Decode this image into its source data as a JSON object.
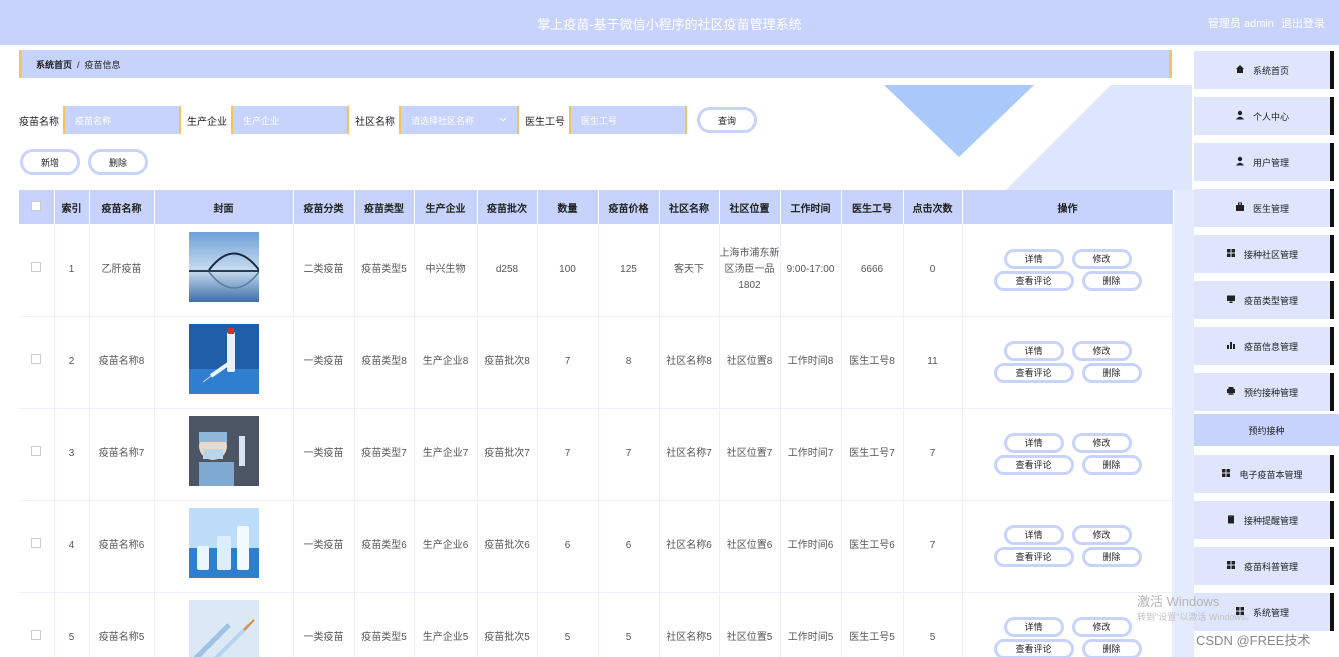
{
  "header": {
    "title": "掌上疫苗-基于微信小程序的社区疫苗管理系统",
    "user_label": "管理员 admin",
    "logout_label": "退出登录"
  },
  "breadcrumb": {
    "home": "系统首页",
    "sep": "/",
    "current": "疫苗信息"
  },
  "search": {
    "name_label": "疫苗名称",
    "name_placeholder": "疫苗名称",
    "company_label": "生产企业",
    "company_placeholder": "生产企业",
    "community_label": "社区名称",
    "community_placeholder": "请选择社区名称",
    "doctor_label": "医生工号",
    "doctor_placeholder": "医生工号",
    "query_label": "查询"
  },
  "actions": {
    "add_label": "新增",
    "delete_label": "删除"
  },
  "table": {
    "headers": [
      "索引",
      "疫苗名称",
      "封面",
      "疫苗分类",
      "疫苗类型",
      "生产企业",
      "疫苗批次",
      "数量",
      "疫苗价格",
      "社区名称",
      "社区位置",
      "工作时间",
      "医生工号",
      "点击次数",
      "操作"
    ],
    "op_labels": {
      "detail": "详情",
      "edit": "修改",
      "comments": "查看评论",
      "delete": "删除"
    },
    "rows": [
      {
        "index": "1",
        "name": "乙肝疫苗",
        "category": "二类疫苗",
        "type": "疫苗类型5",
        "company": "中兴生物",
        "batch": "d258",
        "qty": "100",
        "price": "125",
        "community": "客天下",
        "location": "上海市浦东新区汤臣一品1802",
        "worktime": "9:00-17:00",
        "doctor": "6666",
        "clicks": "0",
        "cover": "bridge"
      },
      {
        "index": "2",
        "name": "疫苗名称8",
        "category": "一类疫苗",
        "type": "疫苗类型8",
        "company": "生产企业8",
        "batch": "疫苗批次8",
        "qty": "7",
        "price": "8",
        "community": "社区名称8",
        "location": "社区位置8",
        "worktime": "工作时间8",
        "doctor": "医生工号8",
        "clicks": "11",
        "cover": "syringe"
      },
      {
        "index": "3",
        "name": "疫苗名称7",
        "category": "一类疫苗",
        "type": "疫苗类型7",
        "company": "生产企业7",
        "batch": "疫苗批次7",
        "qty": "7",
        "price": "7",
        "community": "社区名称7",
        "location": "社区位置7",
        "worktime": "工作时间7",
        "doctor": "医生工号7",
        "clicks": "7",
        "cover": "lab"
      },
      {
        "index": "4",
        "name": "疫苗名称6",
        "category": "一类疫苗",
        "type": "疫苗类型6",
        "company": "生产企业6",
        "batch": "疫苗批次6",
        "qty": "6",
        "price": "6",
        "community": "社区名称6",
        "location": "社区位置6",
        "worktime": "工作时间6",
        "doctor": "医生工号6",
        "clicks": "7",
        "cover": "vials"
      },
      {
        "index": "5",
        "name": "疫苗名称5",
        "category": "一类疫苗",
        "type": "疫苗类型5",
        "company": "生产企业5",
        "batch": "疫苗批次5",
        "qty": "5",
        "price": "5",
        "community": "社区名称5",
        "location": "社区位置5",
        "worktime": "工作时间5",
        "doctor": "医生工号5",
        "clicks": "5",
        "cover": "syringes"
      }
    ]
  },
  "sidebar": {
    "items": [
      {
        "label": "系统首页",
        "icon": "home-icon"
      },
      {
        "label": "个人中心",
        "icon": "user-icon"
      },
      {
        "label": "用户管理",
        "icon": "user-icon"
      },
      {
        "label": "医生管理",
        "icon": "briefcase-icon"
      },
      {
        "label": "接种社区管理",
        "icon": "grid-icon"
      },
      {
        "label": "疫苗类型管理",
        "icon": "monitor-icon"
      },
      {
        "label": "疫苗信息管理",
        "icon": "bar-chart-icon"
      },
      {
        "label": "预约接种管理",
        "icon": "printer-icon"
      },
      {
        "label": "电子疫苗本管理",
        "icon": "grid-icon"
      },
      {
        "label": "接种提醒管理",
        "icon": "clipboard-icon"
      },
      {
        "label": "疫苗科普管理",
        "icon": "grid-icon"
      },
      {
        "label": "系统管理",
        "icon": "grid-icon"
      }
    ],
    "sub_item": "预约接种"
  },
  "watermark": {
    "line1": "激活 Windows",
    "line2": "转到\"设置\"以激活 Windows。"
  },
  "csdn": "CSDN @FREE技术"
}
